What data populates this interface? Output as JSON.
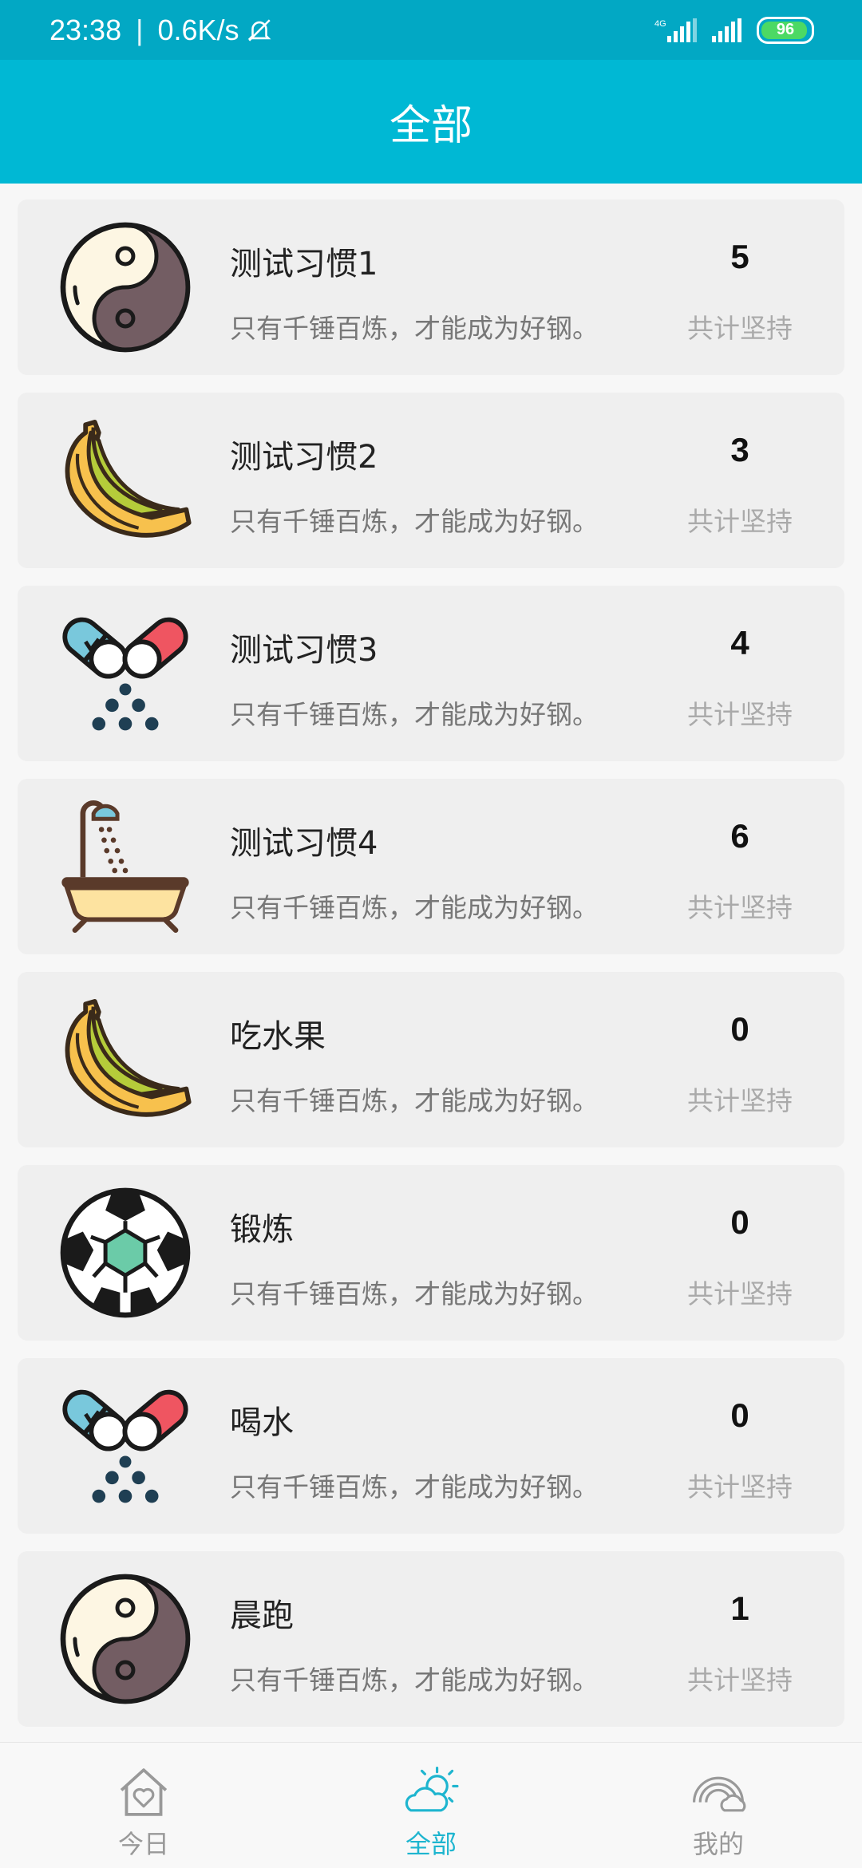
{
  "status_bar": {
    "time": "23:38",
    "speed": "0.6K/s",
    "battery": "96",
    "network": "4G"
  },
  "header": {
    "title": "全部"
  },
  "colors": {
    "primary": "#00b8d4",
    "status_bar": "#02a8c4",
    "battery": "#4cd964"
  },
  "habits": [
    {
      "name": "测试习惯1",
      "motto": "只有千锤百炼，才能成为好钢。",
      "count": "5",
      "count_label": "共计坚持",
      "icon": "yin-yang-icon"
    },
    {
      "name": "测试习惯2",
      "motto": "只有千锤百炼，才能成为好钢。",
      "count": "3",
      "count_label": "共计坚持",
      "icon": "banana-icon"
    },
    {
      "name": "测试习惯3",
      "motto": "只有千锤百炼，才能成为好钢。",
      "count": "4",
      "count_label": "共计坚持",
      "icon": "pills-icon"
    },
    {
      "name": "测试习惯4",
      "motto": "只有千锤百炼，才能成为好钢。",
      "count": "6",
      "count_label": "共计坚持",
      "icon": "bathtub-icon"
    },
    {
      "name": "吃水果",
      "motto": "只有千锤百炼，才能成为好钢。",
      "count": "0",
      "count_label": "共计坚持",
      "icon": "banana-icon"
    },
    {
      "name": "锻炼",
      "motto": "只有千锤百炼，才能成为好钢。",
      "count": "0",
      "count_label": "共计坚持",
      "icon": "soccer-ball-icon"
    },
    {
      "name": "喝水",
      "motto": "只有千锤百炼，才能成为好钢。",
      "count": "0",
      "count_label": "共计坚持",
      "icon": "pills-icon"
    },
    {
      "name": "晨跑",
      "motto": "只有千锤百炼，才能成为好钢。",
      "count": "1",
      "count_label": "共计坚持",
      "icon": "yin-yang-icon"
    }
  ],
  "tabs": [
    {
      "label": "今日",
      "icon": "house-heart-icon",
      "active": false
    },
    {
      "label": "全部",
      "icon": "sun-cloud-icon",
      "active": true
    },
    {
      "label": "我的",
      "icon": "rainbow-cloud-icon",
      "active": false
    }
  ]
}
